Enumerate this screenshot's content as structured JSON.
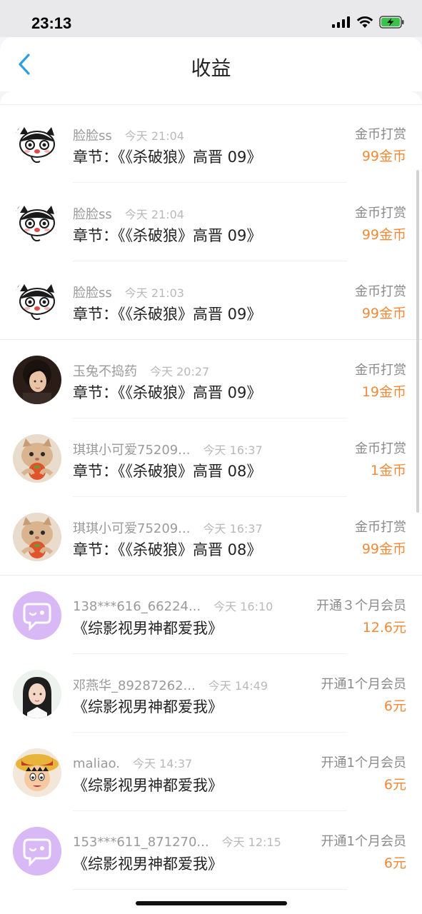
{
  "status_bar": {
    "time": "23:13"
  },
  "header": {
    "title": "收益"
  },
  "rows": [
    {
      "avatar": "cat-icon",
      "username": "脸脸ss",
      "time": "今天 21:04",
      "detail": "章节：《《杀破狼》高晋 09》",
      "type": "金币打赏",
      "amount": "99金币"
    },
    {
      "avatar": "cat-icon",
      "username": "脸脸ss",
      "time": "今天 21:04",
      "detail": "章节：《《杀破狼》高晋 09》",
      "type": "金币打赏",
      "amount": "99金币"
    },
    {
      "avatar": "cat-icon",
      "username": "脸脸ss",
      "time": "今天 21:03",
      "detail": "章节：《《杀破狼》高晋 09》",
      "type": "金币打赏",
      "amount": "99金币"
    },
    {
      "avatar": "portrait-icon",
      "username": "玉兔不捣药",
      "time": "今天 20:27",
      "detail": "章节：《《杀破狼》高晋 09》",
      "type": "金币打赏",
      "amount": "19金币"
    },
    {
      "avatar": "kitten-icon",
      "username": "琪琪小可爱75209...",
      "time": "今天 16:37",
      "detail": "章节：《《杀破狼》高晋 08》",
      "type": "金币打赏",
      "amount": "1金币"
    },
    {
      "avatar": "kitten-icon",
      "username": "琪琪小可爱75209...",
      "time": "今天 16:37",
      "detail": "章节：《《杀破狼》高晋 08》",
      "type": "金币打赏",
      "amount": "99金币"
    },
    {
      "avatar": "chat-bubble-icon",
      "username": "138***616_66224...",
      "time": "今天 16:10",
      "detail": "《综影视男神都爱我》",
      "type": "开通３个月会员",
      "amount": "12.6元"
    },
    {
      "avatar": "girl-portrait-icon",
      "username": "邓燕华_89287262...",
      "time": "今天 14:49",
      "detail": "《综影视男神都爱我》",
      "type": "开通1个月会员",
      "amount": "6元"
    },
    {
      "avatar": "cartoon-boy-icon",
      "username": "maliao.",
      "time": "今天 14:37",
      "detail": "《综影视男神都爱我》",
      "type": "开通1个月会员",
      "amount": "6元"
    },
    {
      "avatar": "chat-bubble-icon",
      "username": "153***611_871270...",
      "time": "今天 12:15",
      "detail": "《综影视男神都爱我》",
      "type": "开通1个月会员",
      "amount": "6元"
    }
  ]
}
